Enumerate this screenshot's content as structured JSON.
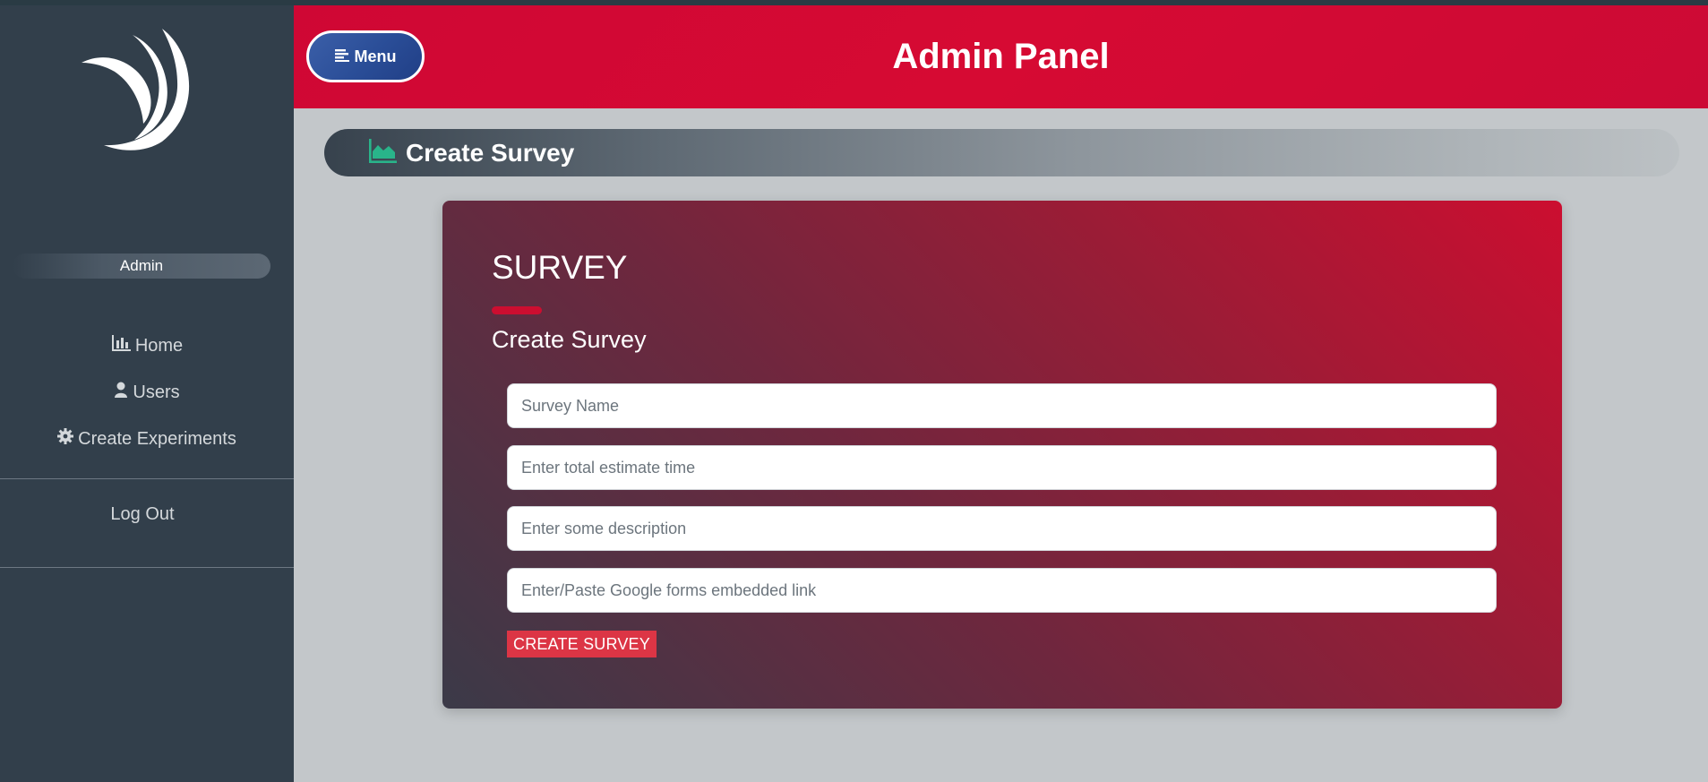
{
  "app": {
    "title": "Admin Panel",
    "menu_label": "Menu"
  },
  "sidebar": {
    "user_name": "Admin",
    "items": [
      {
        "label": "Home",
        "icon": "bar-chart-icon"
      },
      {
        "label": "Users",
        "icon": "user-icon"
      },
      {
        "label": "Create Experiments",
        "icon": "gear-icon"
      }
    ],
    "logout_label": "Log Out"
  },
  "page": {
    "breadcrumb_title": "Create Survey",
    "breadcrumb_icon": "area-chart-icon"
  },
  "form": {
    "title": "SURVEY",
    "subtitle": "Create Survey",
    "fields": {
      "survey_name": {
        "placeholder": "Survey Name",
        "value": ""
      },
      "estimate_time": {
        "placeholder": "Enter total estimate time",
        "value": ""
      },
      "description": {
        "placeholder": "Enter some description",
        "value": ""
      },
      "forms_link": {
        "placeholder": "Enter/Paste Google forms embedded link",
        "value": ""
      }
    },
    "submit_label": "CREATE SURVEY"
  },
  "colors": {
    "header_red": "#d60a33",
    "sidebar_bg": "#323f4b",
    "menu_blue": "#2a4d97",
    "button_red": "#dc3545",
    "icon_green": "#29b48a"
  }
}
